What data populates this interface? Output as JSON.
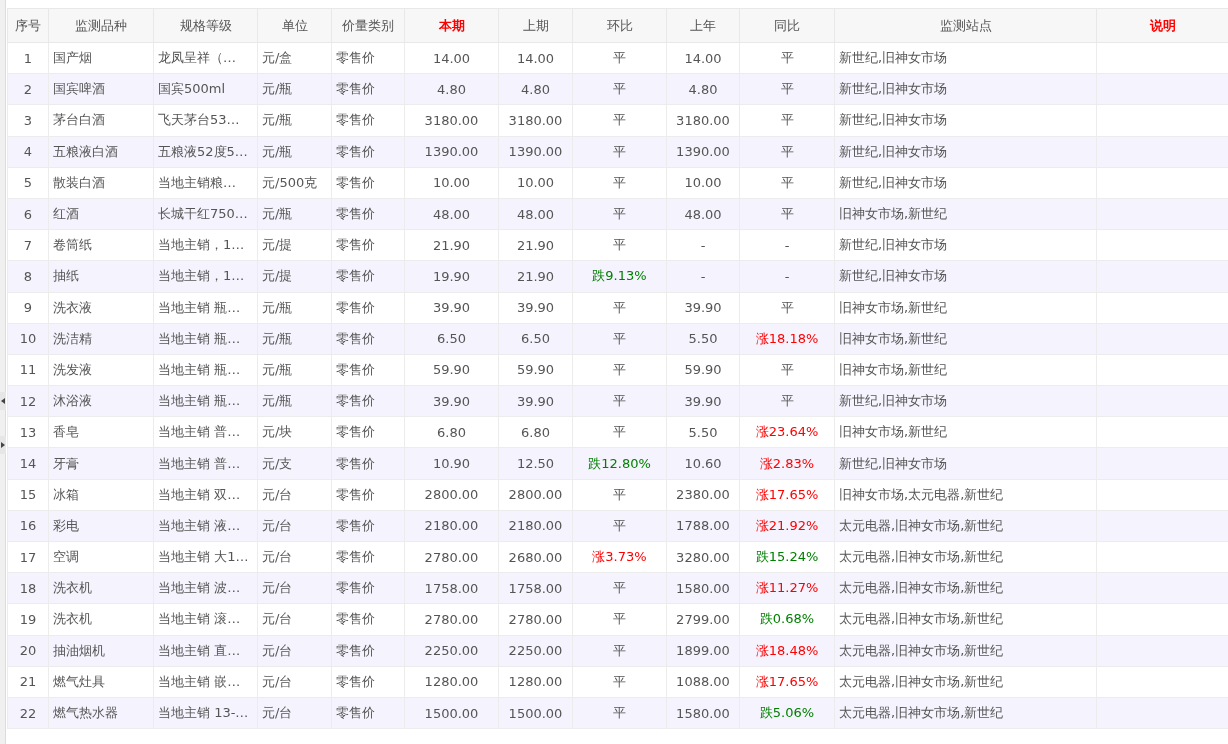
{
  "columns": [
    {
      "label": "序号",
      "highlight": false
    },
    {
      "label": "监测品种",
      "highlight": false
    },
    {
      "label": "规格等级",
      "highlight": false
    },
    {
      "label": "单位",
      "highlight": false
    },
    {
      "label": "价量类别",
      "highlight": false
    },
    {
      "label": "本期",
      "highlight": true
    },
    {
      "label": "上期",
      "highlight": false
    },
    {
      "label": "环比",
      "highlight": false
    },
    {
      "label": "上年",
      "highlight": false
    },
    {
      "label": "同比",
      "highlight": false
    },
    {
      "label": "监测站点",
      "highlight": false
    },
    {
      "label": "说明",
      "highlight": true
    }
  ],
  "rows": [
    {
      "no": "1",
      "item": "国产烟",
      "spec": "龙凤呈祥（…",
      "unit": "元/盒",
      "type": "零售价",
      "current": "14.00",
      "previous": "14.00",
      "mom": {
        "text": "平"
      },
      "last_year": "14.00",
      "yoy": {
        "text": "平"
      },
      "sites": "新世纪,旧神女市场"
    },
    {
      "no": "2",
      "item": "国宾啤酒",
      "spec": "国宾500ml",
      "unit": "元/瓶",
      "type": "零售价",
      "current": "4.80",
      "previous": "4.80",
      "mom": {
        "text": "平"
      },
      "last_year": "4.80",
      "yoy": {
        "text": "平"
      },
      "sites": "新世纪,旧神女市场"
    },
    {
      "no": "3",
      "item": "茅台白酒",
      "spec": "飞天茅台53…",
      "unit": "元/瓶",
      "type": "零售价",
      "current": "3180.00",
      "previous": "3180.00",
      "mom": {
        "text": "平"
      },
      "last_year": "3180.00",
      "yoy": {
        "text": "平"
      },
      "sites": "新世纪,旧神女市场"
    },
    {
      "no": "4",
      "item": "五粮液白酒",
      "spec": "五粮液52度5…",
      "unit": "元/瓶",
      "type": "零售价",
      "current": "1390.00",
      "previous": "1390.00",
      "mom": {
        "text": "平"
      },
      "last_year": "1390.00",
      "yoy": {
        "text": "平"
      },
      "sites": "新世纪,旧神女市场"
    },
    {
      "no": "5",
      "item": "散装白酒",
      "spec": "当地主销粮…",
      "unit": "元/500克",
      "type": "零售价",
      "current": "10.00",
      "previous": "10.00",
      "mom": {
        "text": "平"
      },
      "last_year": "10.00",
      "yoy": {
        "text": "平"
      },
      "sites": "新世纪,旧神女市场"
    },
    {
      "no": "6",
      "item": "红酒",
      "spec": "长城干红750…",
      "unit": "元/瓶",
      "type": "零售价",
      "current": "48.00",
      "previous": "48.00",
      "mom": {
        "text": "平"
      },
      "last_year": "48.00",
      "yoy": {
        "text": "平"
      },
      "sites": "旧神女市场,新世纪"
    },
    {
      "no": "7",
      "item": "卷筒纸",
      "spec": "当地主销，1…",
      "unit": "元/提",
      "type": "零售价",
      "current": "21.90",
      "previous": "21.90",
      "mom": {
        "text": "平"
      },
      "last_year": "-",
      "yoy": {
        "text": "-"
      },
      "sites": "新世纪,旧神女市场"
    },
    {
      "no": "8",
      "item": "抽纸",
      "spec": "当地主销，1…",
      "unit": "元/提",
      "type": "零售价",
      "current": "19.90",
      "previous": "21.90",
      "mom": {
        "text": "跌9.13%",
        "color": "#008000"
      },
      "last_year": "-",
      "yoy": {
        "text": "-"
      },
      "sites": "新世纪,旧神女市场"
    },
    {
      "no": "9",
      "item": "洗衣液",
      "spec": "当地主销 瓶…",
      "unit": "元/瓶",
      "type": "零售价",
      "current": "39.90",
      "previous": "39.90",
      "mom": {
        "text": "平"
      },
      "last_year": "39.90",
      "yoy": {
        "text": "平"
      },
      "sites": "旧神女市场,新世纪"
    },
    {
      "no": "10",
      "item": "洗洁精",
      "spec": "当地主销 瓶…",
      "unit": "元/瓶",
      "type": "零售价",
      "current": "6.50",
      "previous": "6.50",
      "mom": {
        "text": "平"
      },
      "last_year": "5.50",
      "yoy": {
        "text": "涨18.18%",
        "color": "#ff0000"
      },
      "sites": "旧神女市场,新世纪"
    },
    {
      "no": "11",
      "item": "洗发液",
      "spec": "当地主销 瓶…",
      "unit": "元/瓶",
      "type": "零售价",
      "current": "59.90",
      "previous": "59.90",
      "mom": {
        "text": "平"
      },
      "last_year": "59.90",
      "yoy": {
        "text": "平"
      },
      "sites": "旧神女市场,新世纪"
    },
    {
      "no": "12",
      "item": "沐浴液",
      "spec": "当地主销 瓶…",
      "unit": "元/瓶",
      "type": "零售价",
      "current": "39.90",
      "previous": "39.90",
      "mom": {
        "text": "平"
      },
      "last_year": "39.90",
      "yoy": {
        "text": "平"
      },
      "sites": "新世纪,旧神女市场"
    },
    {
      "no": "13",
      "item": "香皂",
      "spec": "当地主销 普…",
      "unit": "元/块",
      "type": "零售价",
      "current": "6.80",
      "previous": "6.80",
      "mom": {
        "text": "平"
      },
      "last_year": "5.50",
      "yoy": {
        "text": "涨23.64%",
        "color": "#ff0000"
      },
      "sites": "旧神女市场,新世纪"
    },
    {
      "no": "14",
      "item": "牙膏",
      "spec": "当地主销 普…",
      "unit": "元/支",
      "type": "零售价",
      "current": "10.90",
      "previous": "12.50",
      "mom": {
        "text": "跌12.80%",
        "color": "#008000"
      },
      "last_year": "10.60",
      "yoy": {
        "text": "涨2.83%",
        "color": "#ff0000"
      },
      "sites": "新世纪,旧神女市场"
    },
    {
      "no": "15",
      "item": "冰箱",
      "spec": "当地主销 双…",
      "unit": "元/台",
      "type": "零售价",
      "current": "2800.00",
      "previous": "2800.00",
      "mom": {
        "text": "平"
      },
      "last_year": "2380.00",
      "yoy": {
        "text": "涨17.65%",
        "color": "#ff0000"
      },
      "sites": "旧神女市场,太元电器,新世纪"
    },
    {
      "no": "16",
      "item": "彩电",
      "spec": "当地主销 液…",
      "unit": "元/台",
      "type": "零售价",
      "current": "2180.00",
      "previous": "2180.00",
      "mom": {
        "text": "平"
      },
      "last_year": "1788.00",
      "yoy": {
        "text": "涨21.92%",
        "color": "#ff0000"
      },
      "sites": "太元电器,旧神女市场,新世纪"
    },
    {
      "no": "17",
      "item": "空调",
      "spec": "当地主销 大1…",
      "unit": "元/台",
      "type": "零售价",
      "current": "2780.00",
      "previous": "2680.00",
      "mom": {
        "text": "涨3.73%",
        "color": "#ff0000"
      },
      "last_year": "3280.00",
      "yoy": {
        "text": "跌15.24%",
        "color": "#008000"
      },
      "sites": "太元电器,旧神女市场,新世纪"
    },
    {
      "no": "18",
      "item": "洗衣机",
      "spec": "当地主销 波…",
      "unit": "元/台",
      "type": "零售价",
      "current": "1758.00",
      "previous": "1758.00",
      "mom": {
        "text": "平"
      },
      "last_year": "1580.00",
      "yoy": {
        "text": "涨11.27%",
        "color": "#ff0000"
      },
      "sites": "太元电器,旧神女市场,新世纪"
    },
    {
      "no": "19",
      "item": "洗衣机",
      "spec": "当地主销 滚…",
      "unit": "元/台",
      "type": "零售价",
      "current": "2780.00",
      "previous": "2780.00",
      "mom": {
        "text": "平"
      },
      "last_year": "2799.00",
      "yoy": {
        "text": "跌0.68%",
        "color": "#008000"
      },
      "sites": "太元电器,旧神女市场,新世纪"
    },
    {
      "no": "20",
      "item": "抽油烟机",
      "spec": "当地主销 直…",
      "unit": "元/台",
      "type": "零售价",
      "current": "2250.00",
      "previous": "2250.00",
      "mom": {
        "text": "平"
      },
      "last_year": "1899.00",
      "yoy": {
        "text": "涨18.48%",
        "color": "#ff0000"
      },
      "sites": "太元电器,旧神女市场,新世纪"
    },
    {
      "no": "21",
      "item": "燃气灶具",
      "spec": "当地主销 嵌…",
      "unit": "元/台",
      "type": "零售价",
      "current": "1280.00",
      "previous": "1280.00",
      "mom": {
        "text": "平"
      },
      "last_year": "1088.00",
      "yoy": {
        "text": "涨17.65%",
        "color": "#ff0000"
      },
      "sites": "太元电器,旧神女市场,新世纪"
    },
    {
      "no": "22",
      "item": "燃气热水器",
      "spec": "当地主销 13-…",
      "unit": "元/台",
      "type": "零售价",
      "current": "1500.00",
      "previous": "1500.00",
      "mom": {
        "text": "平"
      },
      "last_year": "1580.00",
      "yoy": {
        "text": "跌5.06%",
        "color": "#008000"
      },
      "sites": "太元电器,旧神女市场,新世纪"
    }
  ]
}
